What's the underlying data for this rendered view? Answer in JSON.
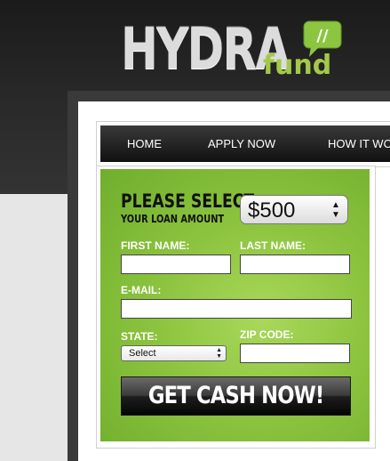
{
  "logo": {
    "brand": "HYDRA",
    "suffix": "fund",
    "bubble_mark": "//"
  },
  "nav": {
    "items": [
      "HOME",
      "APPLY NOW",
      "HOW IT WO"
    ]
  },
  "form": {
    "heading": "PLEASE SELECT",
    "subheading": "YOUR LOAN AMOUNT",
    "amount": "$500",
    "first_name_label": "FIRST NAME:",
    "first_name_value": "",
    "last_name_label": "LAST NAME:",
    "last_name_value": "",
    "email_label": "E-MAIL:",
    "email_value": "",
    "state_label": "STATE:",
    "state_value": "Select",
    "zip_label": "ZIP CODE:",
    "zip_value": "",
    "submit_label": "GET CASH NOW!"
  },
  "colors": {
    "brand_green": "#a4c94a",
    "form_green": "#8dc43f",
    "header_dark": "#1b1b1b"
  }
}
